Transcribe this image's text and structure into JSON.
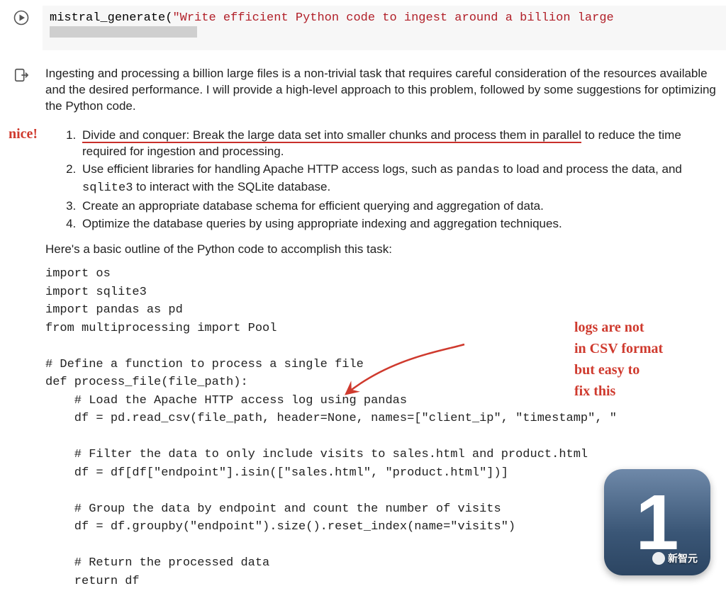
{
  "code_cell": {
    "function_name": "mistral_generate",
    "string_arg": "\"Write efficient Python code to ingest around a billion large"
  },
  "output": {
    "intro": "Ingesting and processing a billion large files is a non-trivial task that requires careful consideration of the resources available and the desired performance. I will provide a high-level approach to this problem, followed by some suggestions for optimizing the Python code.",
    "steps": {
      "item1_underlined": "Divide and conquer: Break the large data set into smaller chunks and process them in parallel",
      "item1_rest": " to reduce the time required for ingestion and processing.",
      "item2_a": "Use efficient libraries for handling Apache HTTP access logs, such as ",
      "item2_code1": "pandas",
      "item2_b": " to load and process the data, and ",
      "item2_code2": "sqlite3",
      "item2_c": " to interact with the SQLite database.",
      "item3": "Create an appropriate database schema for efficient querying and aggregation of data.",
      "item4": "Optimize the database queries by using appropriate indexing and aggregation techniques."
    },
    "outline_label": "Here's a basic outline of the Python code to accomplish this task:",
    "code": "import os\nimport sqlite3\nimport pandas as pd\nfrom multiprocessing import Pool\n\n# Define a function to process a single file\ndef process_file(file_path):\n    # Load the Apache HTTP access log using pandas\n    df = pd.read_csv(file_path, header=None, names=[\"client_ip\", \"timestamp\", \"\n\n    # Filter the data to only include visits to sales.html and product.html\n    df = df[df[\"endpoint\"].isin([\"sales.html\", \"product.html\"])]\n\n    # Group the data by endpoint and count the number of visits\n    df = df.groupby(\"endpoint\").size().reset_index(name=\"visits\")\n\n    # Return the processed data\n    return df"
  },
  "annotations": {
    "nice": "nice!",
    "logs_line1": "logs are not",
    "logs_line2": "in CSV format",
    "logs_line3": "but easy to",
    "logs_line4": "fix this"
  },
  "badge": {
    "number": "1",
    "watermark_text": "新智元"
  }
}
